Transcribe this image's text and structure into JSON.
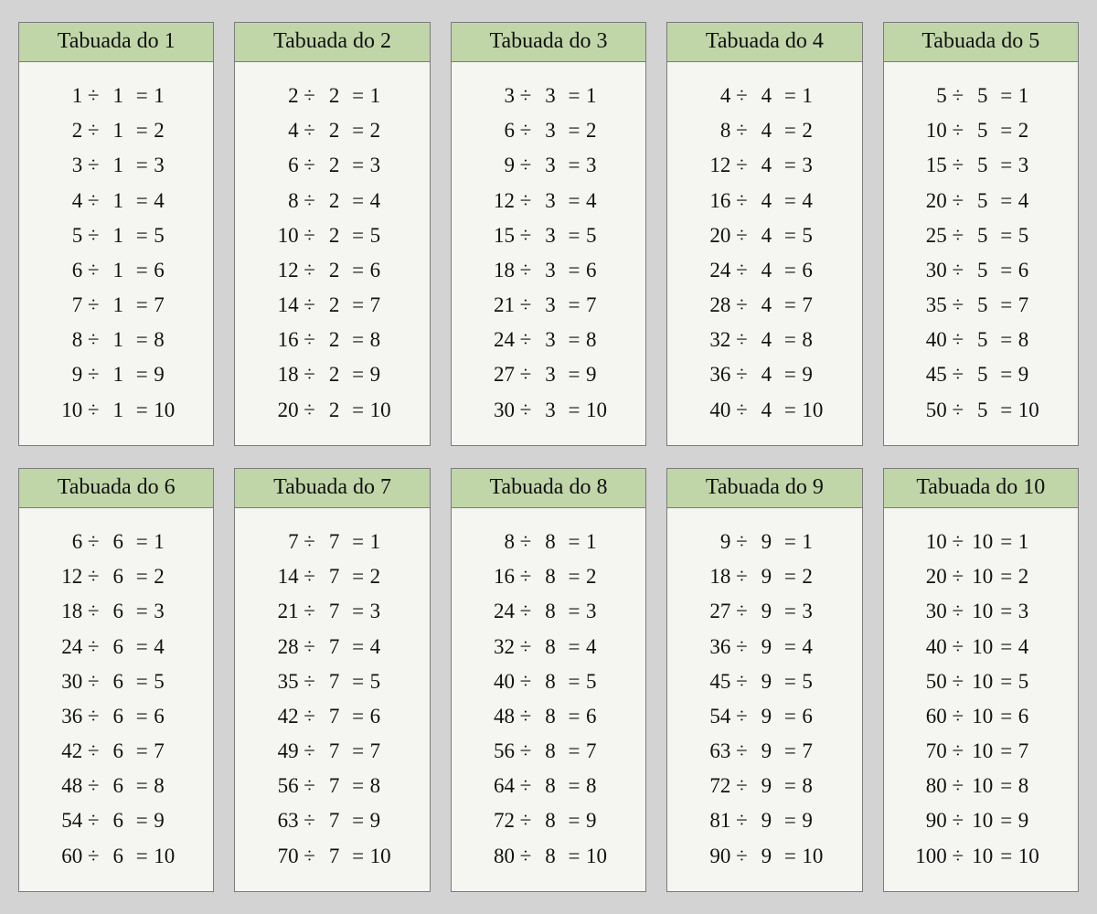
{
  "title_prefix": "Tabuada do ",
  "operator": "÷",
  "equals": "=",
  "tables": [
    {
      "n": 1,
      "rows": [
        {
          "a": 1,
          "b": 1,
          "r": 1
        },
        {
          "a": 2,
          "b": 1,
          "r": 2
        },
        {
          "a": 3,
          "b": 1,
          "r": 3
        },
        {
          "a": 4,
          "b": 1,
          "r": 4
        },
        {
          "a": 5,
          "b": 1,
          "r": 5
        },
        {
          "a": 6,
          "b": 1,
          "r": 6
        },
        {
          "a": 7,
          "b": 1,
          "r": 7
        },
        {
          "a": 8,
          "b": 1,
          "r": 8
        },
        {
          "a": 9,
          "b": 1,
          "r": 9
        },
        {
          "a": 10,
          "b": 1,
          "r": 10
        }
      ]
    },
    {
      "n": 2,
      "rows": [
        {
          "a": 2,
          "b": 2,
          "r": 1
        },
        {
          "a": 4,
          "b": 2,
          "r": 2
        },
        {
          "a": 6,
          "b": 2,
          "r": 3
        },
        {
          "a": 8,
          "b": 2,
          "r": 4
        },
        {
          "a": 10,
          "b": 2,
          "r": 5
        },
        {
          "a": 12,
          "b": 2,
          "r": 6
        },
        {
          "a": 14,
          "b": 2,
          "r": 7
        },
        {
          "a": 16,
          "b": 2,
          "r": 8
        },
        {
          "a": 18,
          "b": 2,
          "r": 9
        },
        {
          "a": 20,
          "b": 2,
          "r": 10
        }
      ]
    },
    {
      "n": 3,
      "rows": [
        {
          "a": 3,
          "b": 3,
          "r": 1
        },
        {
          "a": 6,
          "b": 3,
          "r": 2
        },
        {
          "a": 9,
          "b": 3,
          "r": 3
        },
        {
          "a": 12,
          "b": 3,
          "r": 4
        },
        {
          "a": 15,
          "b": 3,
          "r": 5
        },
        {
          "a": 18,
          "b": 3,
          "r": 6
        },
        {
          "a": 21,
          "b": 3,
          "r": 7
        },
        {
          "a": 24,
          "b": 3,
          "r": 8
        },
        {
          "a": 27,
          "b": 3,
          "r": 9
        },
        {
          "a": 30,
          "b": 3,
          "r": 10
        }
      ]
    },
    {
      "n": 4,
      "rows": [
        {
          "a": 4,
          "b": 4,
          "r": 1
        },
        {
          "a": 8,
          "b": 4,
          "r": 2
        },
        {
          "a": 12,
          "b": 4,
          "r": 3
        },
        {
          "a": 16,
          "b": 4,
          "r": 4
        },
        {
          "a": 20,
          "b": 4,
          "r": 5
        },
        {
          "a": 24,
          "b": 4,
          "r": 6
        },
        {
          "a": 28,
          "b": 4,
          "r": 7
        },
        {
          "a": 32,
          "b": 4,
          "r": 8
        },
        {
          "a": 36,
          "b": 4,
          "r": 9
        },
        {
          "a": 40,
          "b": 4,
          "r": 10
        }
      ]
    },
    {
      "n": 5,
      "rows": [
        {
          "a": 5,
          "b": 5,
          "r": 1
        },
        {
          "a": 10,
          "b": 5,
          "r": 2
        },
        {
          "a": 15,
          "b": 5,
          "r": 3
        },
        {
          "a": 20,
          "b": 5,
          "r": 4
        },
        {
          "a": 25,
          "b": 5,
          "r": 5
        },
        {
          "a": 30,
          "b": 5,
          "r": 6
        },
        {
          "a": 35,
          "b": 5,
          "r": 7
        },
        {
          "a": 40,
          "b": 5,
          "r": 8
        },
        {
          "a": 45,
          "b": 5,
          "r": 9
        },
        {
          "a": 50,
          "b": 5,
          "r": 10
        }
      ]
    },
    {
      "n": 6,
      "rows": [
        {
          "a": 6,
          "b": 6,
          "r": 1
        },
        {
          "a": 12,
          "b": 6,
          "r": 2
        },
        {
          "a": 18,
          "b": 6,
          "r": 3
        },
        {
          "a": 24,
          "b": 6,
          "r": 4
        },
        {
          "a": 30,
          "b": 6,
          "r": 5
        },
        {
          "a": 36,
          "b": 6,
          "r": 6
        },
        {
          "a": 42,
          "b": 6,
          "r": 7
        },
        {
          "a": 48,
          "b": 6,
          "r": 8
        },
        {
          "a": 54,
          "b": 6,
          "r": 9
        },
        {
          "a": 60,
          "b": 6,
          "r": 10
        }
      ]
    },
    {
      "n": 7,
      "rows": [
        {
          "a": 7,
          "b": 7,
          "r": 1
        },
        {
          "a": 14,
          "b": 7,
          "r": 2
        },
        {
          "a": 21,
          "b": 7,
          "r": 3
        },
        {
          "a": 28,
          "b": 7,
          "r": 4
        },
        {
          "a": 35,
          "b": 7,
          "r": 5
        },
        {
          "a": 42,
          "b": 7,
          "r": 6
        },
        {
          "a": 49,
          "b": 7,
          "r": 7
        },
        {
          "a": 56,
          "b": 7,
          "r": 8
        },
        {
          "a": 63,
          "b": 7,
          "r": 9
        },
        {
          "a": 70,
          "b": 7,
          "r": 10
        }
      ]
    },
    {
      "n": 8,
      "rows": [
        {
          "a": 8,
          "b": 8,
          "r": 1
        },
        {
          "a": 16,
          "b": 8,
          "r": 2
        },
        {
          "a": 24,
          "b": 8,
          "r": 3
        },
        {
          "a": 32,
          "b": 8,
          "r": 4
        },
        {
          "a": 40,
          "b": 8,
          "r": 5
        },
        {
          "a": 48,
          "b": 8,
          "r": 6
        },
        {
          "a": 56,
          "b": 8,
          "r": 7
        },
        {
          "a": 64,
          "b": 8,
          "r": 8
        },
        {
          "a": 72,
          "b": 8,
          "r": 9
        },
        {
          "a": 80,
          "b": 8,
          "r": 10
        }
      ]
    },
    {
      "n": 9,
      "rows": [
        {
          "a": 9,
          "b": 9,
          "r": 1
        },
        {
          "a": 18,
          "b": 9,
          "r": 2
        },
        {
          "a": 27,
          "b": 9,
          "r": 3
        },
        {
          "a": 36,
          "b": 9,
          "r": 4
        },
        {
          "a": 45,
          "b": 9,
          "r": 5
        },
        {
          "a": 54,
          "b": 9,
          "r": 6
        },
        {
          "a": 63,
          "b": 9,
          "r": 7
        },
        {
          "a": 72,
          "b": 9,
          "r": 8
        },
        {
          "a": 81,
          "b": 9,
          "r": 9
        },
        {
          "a": 90,
          "b": 9,
          "r": 10
        }
      ]
    },
    {
      "n": 10,
      "rows": [
        {
          "a": 10,
          "b": 10,
          "r": 1
        },
        {
          "a": 20,
          "b": 10,
          "r": 2
        },
        {
          "a": 30,
          "b": 10,
          "r": 3
        },
        {
          "a": 40,
          "b": 10,
          "r": 4
        },
        {
          "a": 50,
          "b": 10,
          "r": 5
        },
        {
          "a": 60,
          "b": 10,
          "r": 6
        },
        {
          "a": 70,
          "b": 10,
          "r": 7
        },
        {
          "a": 80,
          "b": 10,
          "r": 8
        },
        {
          "a": 90,
          "b": 10,
          "r": 9
        },
        {
          "a": 100,
          "b": 10,
          "r": 10
        }
      ]
    }
  ]
}
